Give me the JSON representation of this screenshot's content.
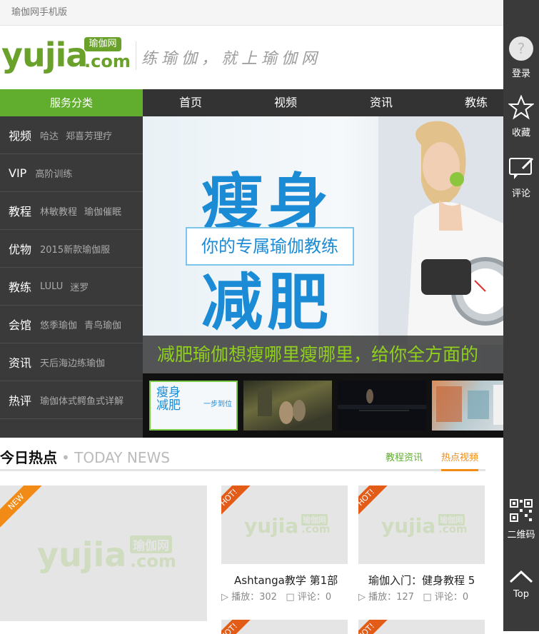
{
  "topbar": {
    "title": "瑜伽网手机版"
  },
  "header": {
    "logo_main": "yujia",
    "logo_dotcom": ".com",
    "logo_badge": "瑜伽网",
    "slogan": "练瑜伽，就上瑜伽网"
  },
  "nav": {
    "category_label": "服务分类",
    "items": [
      {
        "label": "首页"
      },
      {
        "label": "视频"
      },
      {
        "label": "资讯"
      },
      {
        "label": "教练"
      }
    ]
  },
  "categories": [
    {
      "name": "视频",
      "links": [
        "哈达",
        "郑喜芳理疗"
      ]
    },
    {
      "name": "VIP",
      "links": [
        "高阶训练"
      ]
    },
    {
      "name": "教程",
      "links": [
        "林敏教程",
        "瑜伽催眠"
      ]
    },
    {
      "name": "优物",
      "links": [
        "2015新款瑜伽服"
      ]
    },
    {
      "name": "教练",
      "links": [
        "LULU",
        "迷罗"
      ]
    },
    {
      "name": "会馆",
      "links": [
        "悠季瑜伽",
        "青鸟瑜伽"
      ]
    },
    {
      "name": "资讯",
      "links": [
        "天后海边练瑜伽"
      ]
    },
    {
      "name": "热评",
      "links": [
        "瑜伽体式鳄鱼式详解"
      ]
    }
  ],
  "banner": {
    "big_line1": "瘦身",
    "big_line2": "减肥",
    "subtitle": "你的专属瑜伽教练",
    "caption": "减肥瑜伽想瘦哪里瘦哪里，给你全方面的"
  },
  "thumbnails": [
    {
      "text_main": "瘦身减肥",
      "text_side": "一步到位"
    },
    {
      "text_main": ""
    },
    {
      "text_main": ""
    },
    {
      "text_main": ""
    }
  ],
  "news": {
    "title": "今日热点",
    "subtitle": "• TODAY NEWS",
    "tabs": [
      {
        "label": "教程资讯",
        "active": false
      },
      {
        "label": "热点视频",
        "active": true
      }
    ],
    "featured_badge": "NEW",
    "cards": [
      {
        "badge": "HOT!",
        "title": "Ashtanga教学 第1部",
        "plays": "播放：302",
        "comments": "评论：0"
      },
      {
        "badge": "HOT!",
        "title": "瑜伽入门：健身教程 5",
        "plays": "播放：127",
        "comments": "评论：0"
      }
    ],
    "watermark_main": "yujia",
    "watermark_sub": ".com",
    "watermark_badge": "瑜伽网"
  },
  "sidebar": {
    "login": "登录",
    "favorite": "收藏",
    "comment": "评论",
    "qrcode": "二维码",
    "top": "Top"
  },
  "colors": {
    "brand_green": "#61ae2e",
    "logo_green": "#6aa12b",
    "accent_orange": "#f28a16",
    "dark_bg": "#3a3a3a",
    "banner_blue": "#1b8bd6",
    "caption_green": "#8fd01a"
  }
}
